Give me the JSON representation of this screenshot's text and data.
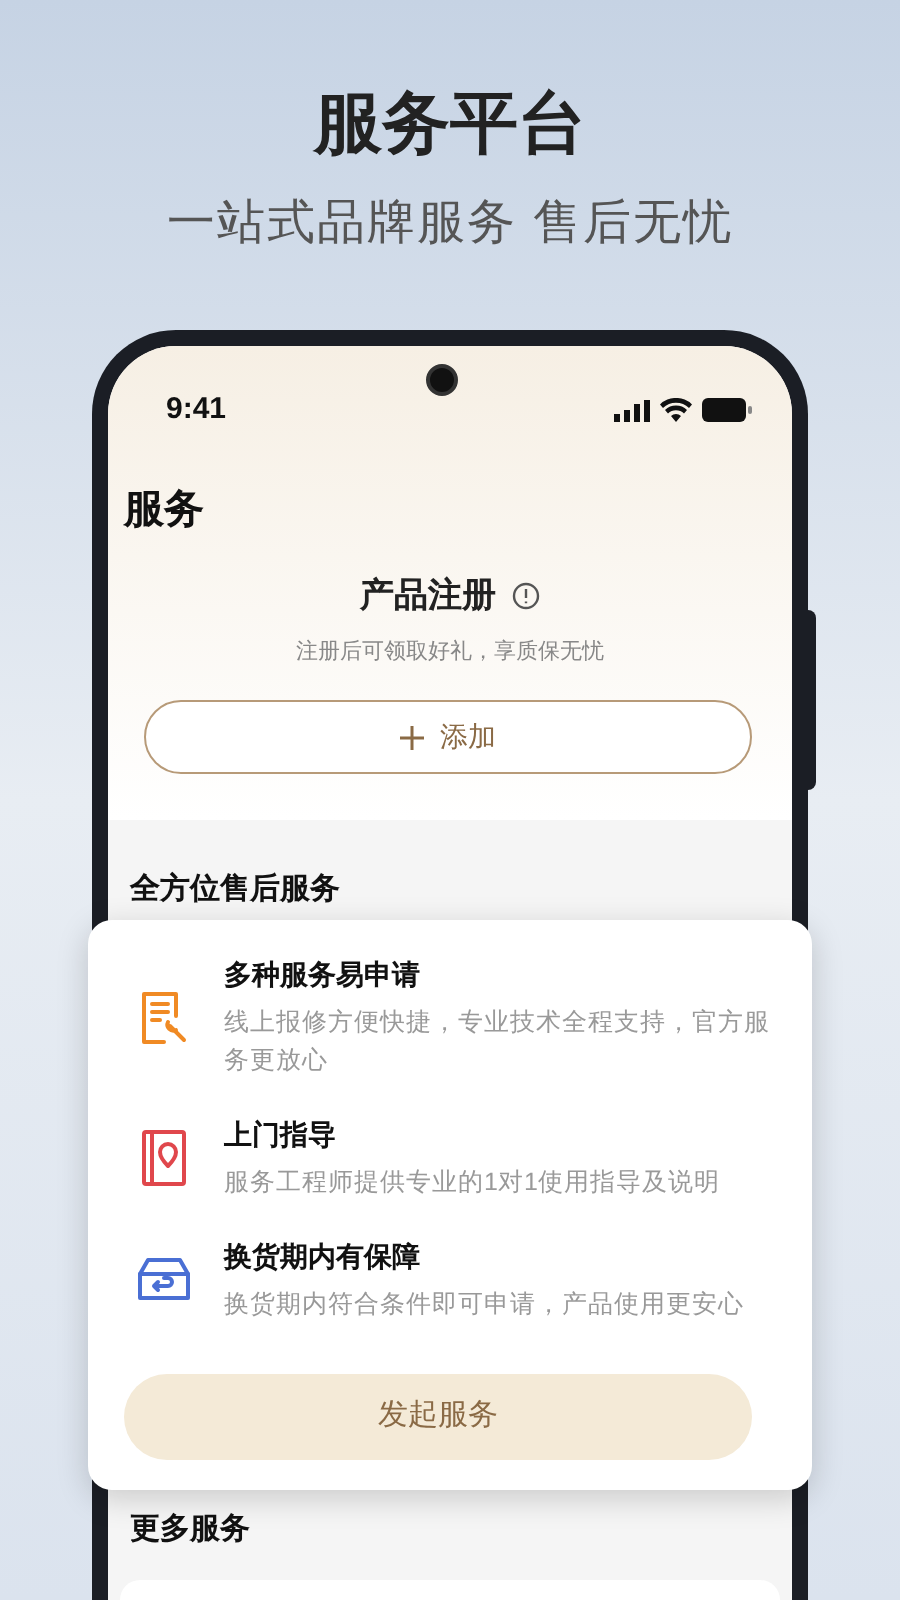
{
  "promo": {
    "title": "服务平台",
    "subtitle": "一站式品牌服务 售后无忧"
  },
  "status_bar": {
    "time": "9:41"
  },
  "page": {
    "title": "服务"
  },
  "registration": {
    "title": "产品注册",
    "hint": "注册后可领取好礼，享质保无忧",
    "add_button": "添加"
  },
  "after_sales": {
    "heading": "全方位售后服务"
  },
  "service_card": {
    "items": [
      {
        "kind": "repair",
        "title": "多种服务易申请",
        "description": "线上报修方便快捷，专业技术全程支持，官方服务更放心"
      },
      {
        "kind": "guide",
        "title": "上门指导",
        "description": "服务工程师提供专业的1对1使用指导及说明"
      },
      {
        "kind": "exchange",
        "title": "换货期内有保障",
        "description": "换货期内符合条件即可申请，产品使用更安心"
      }
    ],
    "button": "发起服务"
  },
  "more_services": {
    "heading": "更多服务"
  }
}
